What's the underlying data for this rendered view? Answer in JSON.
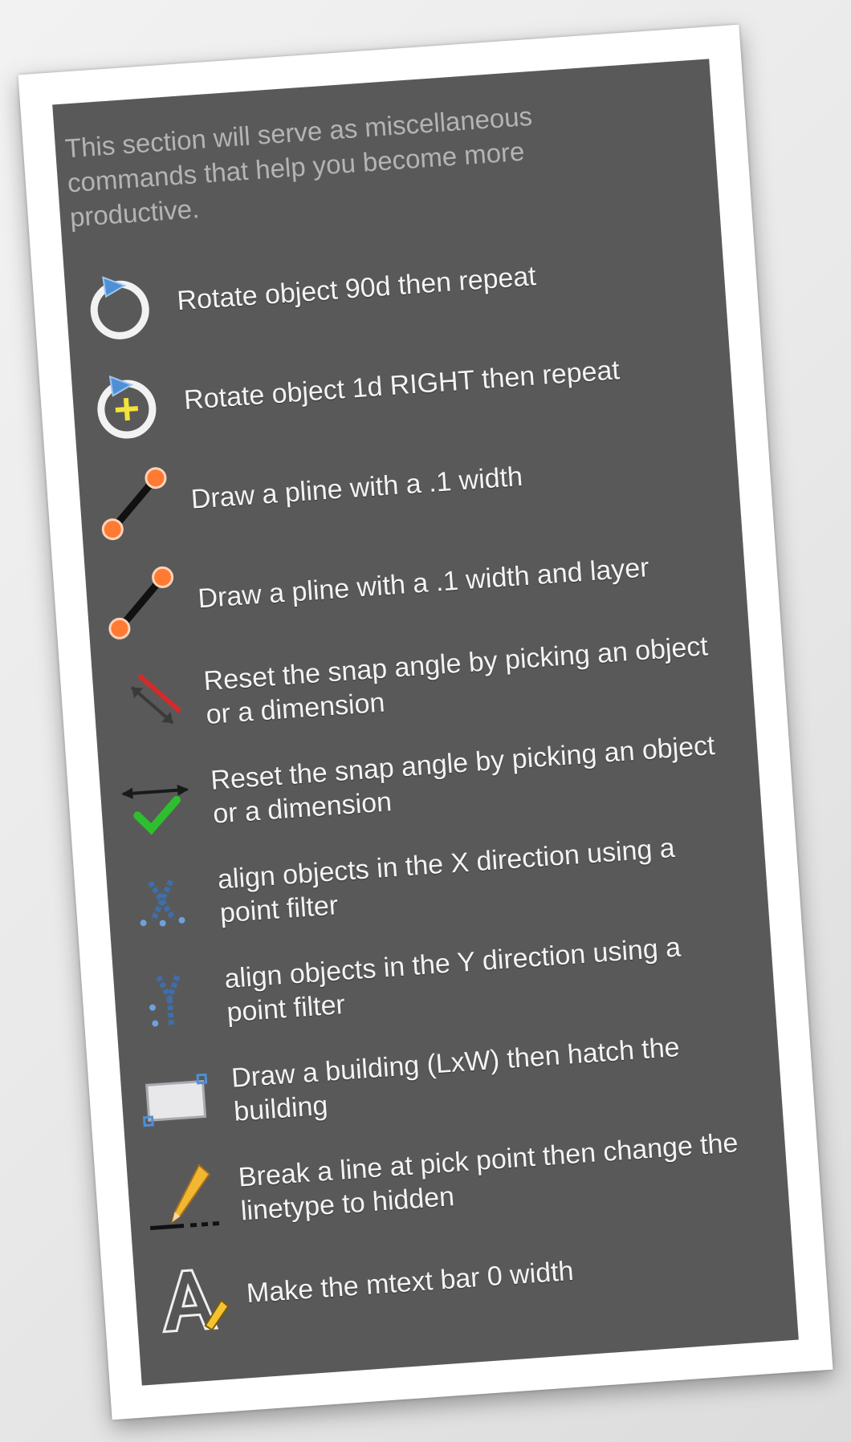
{
  "panel": {
    "intro": "This section will serve as miscellaneous commands that help you become more productive."
  },
  "commands": [
    {
      "icon": "rotate-90-icon",
      "label": "Rotate object 90d then repeat"
    },
    {
      "icon": "rotate-1d-icon",
      "label": "Rotate object 1d RIGHT then repeat"
    },
    {
      "icon": "pline-icon",
      "label": "Draw a pline with a .1 width"
    },
    {
      "icon": "pline-layer-icon",
      "label": "Draw a pline with a .1 width and layer"
    },
    {
      "icon": "snap-angle-pick-icon",
      "label": "Reset the snap angle  by picking an object or a dimension"
    },
    {
      "icon": "snap-angle-reset-icon",
      "label": "Reset the snap angle  by picking an object or a dimension"
    },
    {
      "icon": "align-x-icon",
      "label": "align objects in the X direction using a point filter"
    },
    {
      "icon": "align-y-icon",
      "label": "align objects in the Y direction using a point filter"
    },
    {
      "icon": "building-hatch-icon",
      "label": "Draw a building (LxW) then hatch the building"
    },
    {
      "icon": "break-line-icon",
      "label": "Break a line at pick point then change the linetype to hidden"
    },
    {
      "icon": "mtext-width-icon",
      "label": "Make the mtext bar 0 width"
    }
  ],
  "colors": {
    "panel_bg": "#595959",
    "intro_text": "#b4b4b4",
    "label_text": "#f4f4f4",
    "accent_blue": "#4f8fd6",
    "accent_orange": "#ff7a33",
    "accent_yellow": "#f4e23a",
    "accent_green": "#2dbf2d",
    "accent_red": "#d52a2a"
  }
}
